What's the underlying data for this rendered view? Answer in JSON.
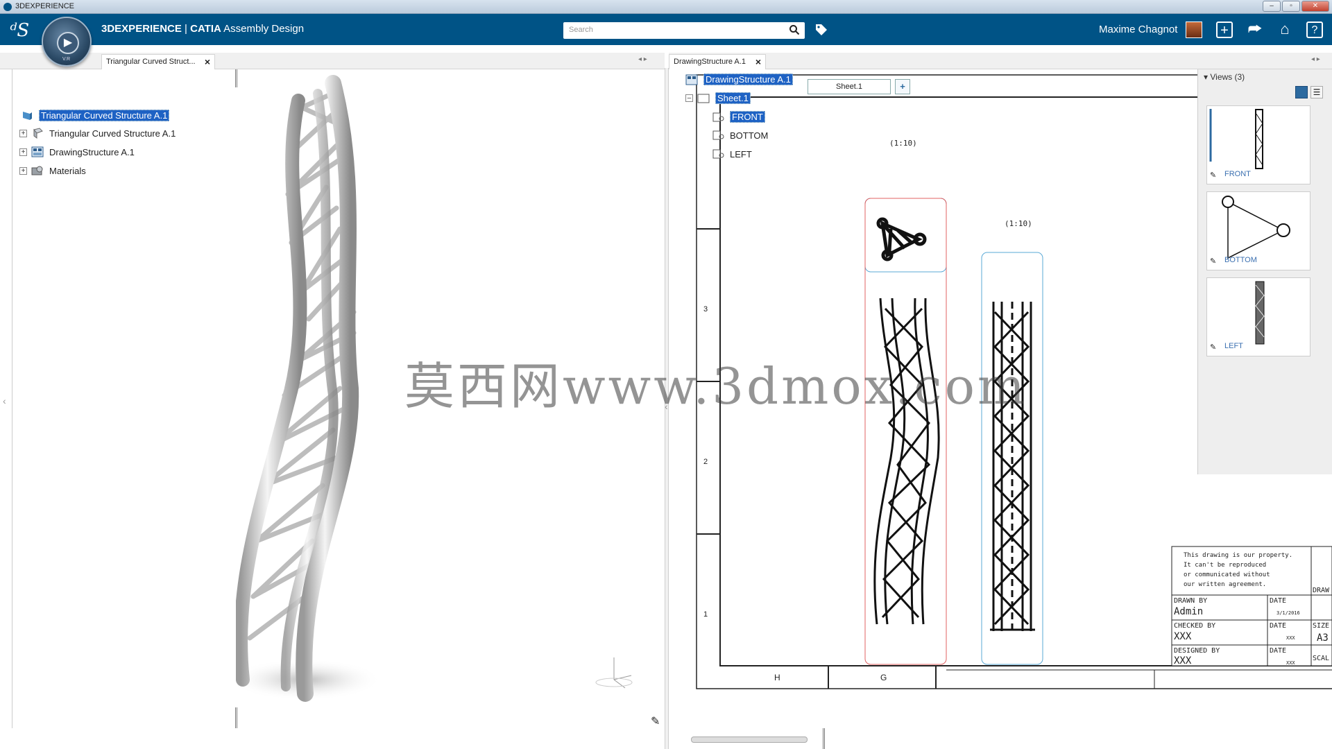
{
  "window": {
    "title": "3DEXPERIENCE"
  },
  "header": {
    "brand": "3DEXPERIENCE",
    "product_bold": "CATIA",
    "app_name": "Assembly Design",
    "search_placeholder": "Search",
    "user_name": "Maxime Chagnot"
  },
  "compass": {
    "label": "V.R"
  },
  "left_tab": {
    "label": "Triangular Curved Struct..."
  },
  "right_tab": {
    "label": "DrawingStructure A.1"
  },
  "left_tree": {
    "root": "Triangular Curved Structure A.1",
    "items": [
      {
        "label": "Triangular Curved Structure A.1"
      },
      {
        "label": "DrawingStructure A.1"
      },
      {
        "label": "Materials"
      }
    ]
  },
  "drawing_tree": {
    "root": "DrawingStructure A.1",
    "sheet": "Sheet.1",
    "views": [
      "FRONT",
      "BOTTOM",
      "LEFT"
    ]
  },
  "sheet_tab": "Sheet.1",
  "drawing": {
    "scale_label_1": "(1:10)",
    "scale_label_2": "(1:10)",
    "row_numbers": [
      "3",
      "2",
      "1"
    ],
    "col_letters": [
      "H",
      "G"
    ],
    "title_block": {
      "notice": [
        "This drawing is our property.",
        "It can't be reproduced",
        "or communicated without",
        "our written agreement."
      ],
      "drawn_by_label": "DRAWN BY",
      "drawn_by": "Admin",
      "date_label": "DATE",
      "drawn_date": "3/1/2016",
      "checked_by_label": "CHECKED BY",
      "checked_by": "XXX",
      "checked_date": "XXX",
      "designed_by_label": "DESIGNED BY",
      "designed_by": "XXX",
      "designed_date": "XXX",
      "size_label": "SIZE",
      "size": "A3",
      "scale_label": "SCAL",
      "draw_label": "DRAW"
    }
  },
  "views_panel": {
    "title": "Views (3)",
    "thumbs": [
      {
        "label": "FRONT"
      },
      {
        "label": "BOTTOM"
      },
      {
        "label": "LEFT"
      }
    ]
  },
  "watermark": "莫西网www.3dmox.com",
  "colors": {
    "topbar": "#005386",
    "selection": "#1e62c4",
    "front_frame": "#e06060",
    "left_frame": "#5aa9d6"
  }
}
